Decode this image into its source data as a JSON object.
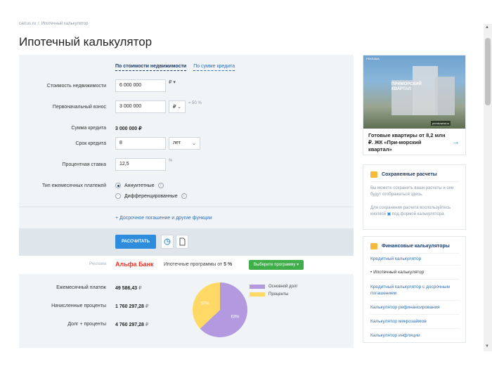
{
  "breadcrumb": [
    "calcus.ru",
    "Ипотечный калькулятор"
  ],
  "page_title": "Ипотечный калькулятор",
  "tabs": [
    "По стоимости недвижимости",
    "По сумме кредита"
  ],
  "form": {
    "property_cost": {
      "label": "Стоимость недвижимости",
      "value": "6 000 000",
      "currency": "₽"
    },
    "down_payment": {
      "label": "Первоначальный взнос",
      "value": "3 000 000",
      "currency": "₽",
      "hint": "= 50 %"
    },
    "loan_amount": {
      "label": "Сумма кредита",
      "value": "3 000 000 ₽"
    },
    "term": {
      "label": "Срок кредита",
      "value": "8",
      "unit": "лет"
    },
    "rate": {
      "label": "Процентная ставка",
      "value": "12,5",
      "unit": "%"
    },
    "payment_type": {
      "label": "Тип ежемесячных платежей",
      "options": [
        "Аннуитетные",
        "Дифференцированные"
      ],
      "selected": "Аннуитетные"
    }
  },
  "extra_link": "+ Досрочное погашение и другие функции",
  "calculate_label": "РАССЧИТАТЬ",
  "ad": {
    "label": "Реклама",
    "bank": "Альфа Банк",
    "text_prefix": "Ипотечные программы от",
    "rate": "5 %",
    "button": "Выберите программу"
  },
  "results": [
    {
      "label": "Ежемесячный платеж",
      "value": "49 586,43",
      "currency": "₽"
    },
    {
      "label": "Начисленные проценты",
      "value": "1 760 297,28",
      "currency": "₽"
    },
    {
      "label": "Долг + проценты",
      "value": "4 760 297,28",
      "currency": "₽"
    }
  ],
  "chart_data": {
    "type": "pie",
    "slices": [
      {
        "name": "Основной долг",
        "value": 63,
        "label": "63%",
        "color": "#b39ae0"
      },
      {
        "name": "Проценты",
        "value": 37,
        "label": "37%",
        "color": "#ffd966"
      }
    ]
  },
  "promo": {
    "brand": "ПРИМОРСКИЙ КВАРТАЛ",
    "tag": "РЕКЛАМА",
    "site": "primkvartal.ru",
    "text": "Готовые квартиры от 8,2 млн ₽. ЖК «При-морский квартал»"
  },
  "saved": {
    "title": "Сохраненные расчеты",
    "text1": "Вы можете сохранить ваши расчеты и они будут отображаться здесь.",
    "text2_before": "Для сохранения расчета воспользуйтесь кнопкой",
    "text2_after": "под формой калькулятора."
  },
  "fin_calcs": {
    "title": "Финансовые калькуляторы",
    "items": [
      "Кредитный калькулятор",
      "Ипотечный калькулятор",
      "Кредитный калькулятор с досрочным погашением",
      "Калькулятор рефинансирования",
      "Калькулятор микрозаймов",
      "Калькулятор инфляции"
    ],
    "current_index": 1
  }
}
